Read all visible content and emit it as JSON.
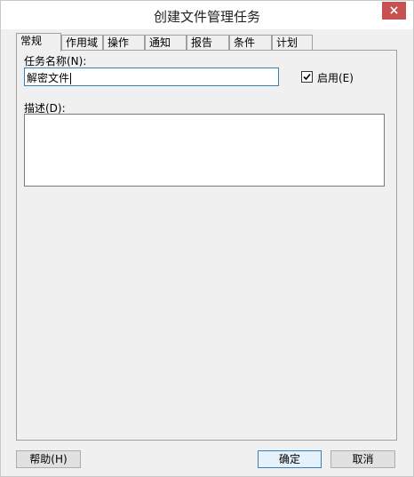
{
  "window": {
    "title": "创建文件管理任务",
    "close_glyph": "×"
  },
  "tabs": [
    {
      "label": "常规",
      "active": true
    },
    {
      "label": "作用域"
    },
    {
      "label": "操作"
    },
    {
      "label": "通知"
    },
    {
      "label": "报告"
    },
    {
      "label": "条件"
    },
    {
      "label": "计划"
    }
  ],
  "general": {
    "task_name_label": "任务名称(N):",
    "task_name_value": "解密文件",
    "enable_label": "启用(E)",
    "enable_checked": true,
    "description_label": "描述(D):",
    "description_value": ""
  },
  "footer": {
    "help_label": "帮助(H)",
    "ok_label": "确定",
    "cancel_label": "取消"
  }
}
